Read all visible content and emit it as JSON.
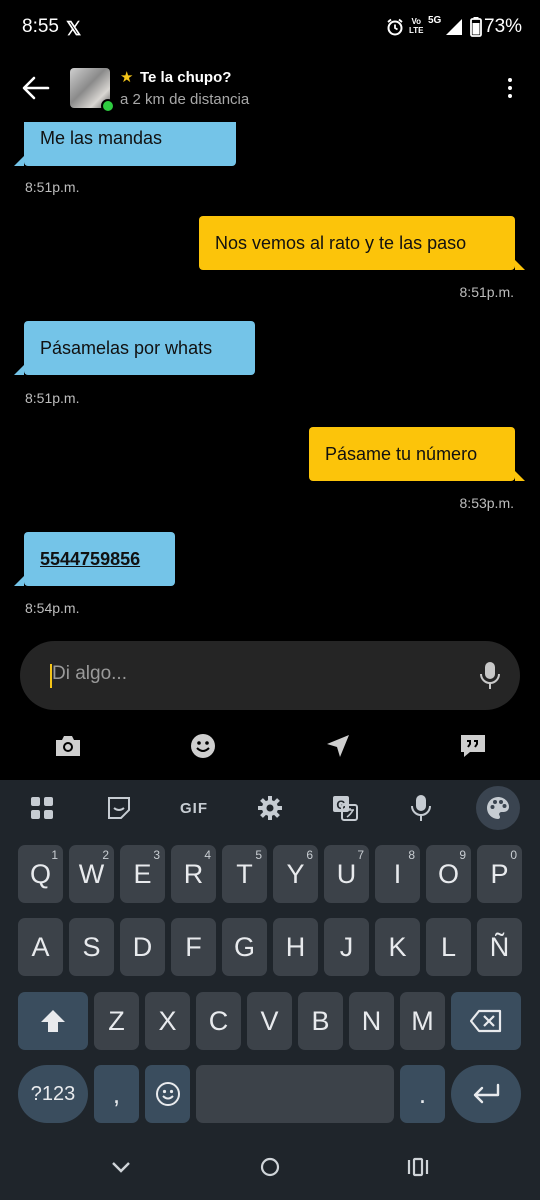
{
  "status_bar": {
    "time": "8:55",
    "x_app_glyph": "𝕏",
    "volte_label": "Vo\nLTE",
    "network": "5G",
    "battery": "73%"
  },
  "header": {
    "contact_name": "Te la chupo?",
    "distance": "a 2 km de distancia",
    "online": true
  },
  "messages": [
    {
      "direction": "in",
      "text": "Me las mandas",
      "time": "8:51p.m."
    },
    {
      "direction": "out",
      "text": "Nos vemos al rato y te las paso",
      "time": "8:51p.m."
    },
    {
      "direction": "in",
      "text": "Pásamelas por whats",
      "time": "8:51p.m."
    },
    {
      "direction": "out",
      "text": "Pásame tu número",
      "time": "8:53p.m."
    },
    {
      "direction": "in",
      "text": "5544759856",
      "time": "8:54p.m."
    }
  ],
  "composer": {
    "placeholder": "Di algo..."
  },
  "toolbar_icons": [
    "camera-icon",
    "emoji-icon",
    "location-icon",
    "quick-replies-icon"
  ],
  "keyboard": {
    "toolbar": {
      "gif_label": "GIF"
    },
    "row1": [
      {
        "label": "Q",
        "hint": "1"
      },
      {
        "label": "W",
        "hint": "2"
      },
      {
        "label": "E",
        "hint": "3"
      },
      {
        "label": "R",
        "hint": "4"
      },
      {
        "label": "T",
        "hint": "5"
      },
      {
        "label": "Y",
        "hint": "6"
      },
      {
        "label": "U",
        "hint": "7"
      },
      {
        "label": "I",
        "hint": "8"
      },
      {
        "label": "O",
        "hint": "9"
      },
      {
        "label": "P",
        "hint": "0"
      }
    ],
    "row2": [
      "A",
      "S",
      "D",
      "F",
      "G",
      "H",
      "J",
      "K",
      "L",
      "Ñ"
    ],
    "row3": [
      "Z",
      "X",
      "C",
      "V",
      "B",
      "N",
      "M"
    ],
    "symbols_label": "?123",
    "comma_label": ",",
    "period_label": "."
  },
  "colors": {
    "incoming_bubble": "#74c4e8",
    "outgoing_bubble": "#fcc40a",
    "background": "#000000",
    "keyboard_bg": "#1f252b",
    "accent_star": "#f5c518"
  }
}
